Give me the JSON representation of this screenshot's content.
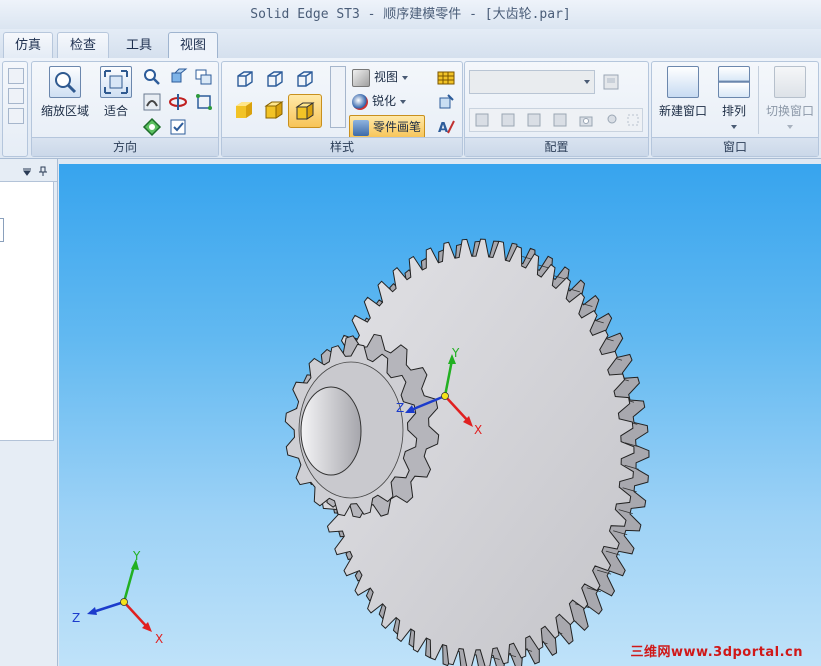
{
  "window": {
    "title": "Solid Edge ST3 - 顺序建模零件 - [大齿轮.par]"
  },
  "tabs": [
    {
      "label": "仿真"
    },
    {
      "label": "检查"
    },
    {
      "label": "工具"
    },
    {
      "label": "视图",
      "active": true
    }
  ],
  "ribbon": {
    "direction": {
      "label": "方向",
      "zoom_area": "缩放区域",
      "fit": "适合"
    },
    "style": {
      "label": "样式",
      "view_style": "视图",
      "sharpen": "锐化",
      "part_painter": "零件画笔"
    },
    "configuration": {
      "label": "配置",
      "dropdown_value": ""
    },
    "window": {
      "label": "窗口",
      "new_window": "新建窗口",
      "arrange": "排列",
      "switch_window": "切换窗口"
    }
  },
  "viewport": {
    "model_axes": {
      "x": "X",
      "y": "Y",
      "z": "Z"
    },
    "corner_axes": {
      "x": "X",
      "y": "Y",
      "z": "Z"
    },
    "watermark": "三维网www.3dportal.cn"
  },
  "colors": {
    "tab_active_bg": "#eef3fa",
    "viewport_top": "#37a4ee",
    "viewport_bottom": "#bfe2f9",
    "gear_face": "#cfcfd3",
    "axis_x": "#e02020",
    "axis_y": "#22b022",
    "axis_z": "#1c3ccc",
    "watermark": "#d01818"
  }
}
